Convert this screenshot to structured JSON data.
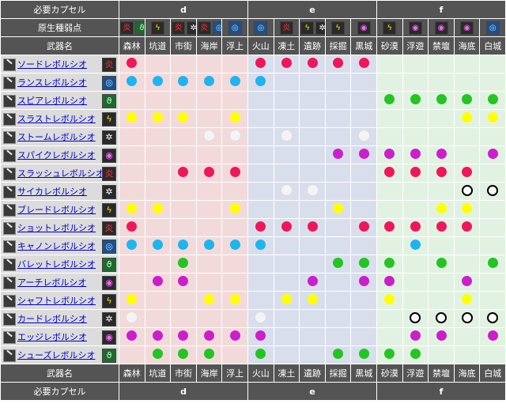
{
  "labels": {
    "capsule": "必要カプセル",
    "weakness": "原生種弱点",
    "weapon": "武器名"
  },
  "sections": [
    "d",
    "e",
    "f"
  ],
  "areas": [
    "森林",
    "坑道",
    "市街",
    "海岸",
    "浮上",
    "火山",
    "凍土",
    "遺跡",
    "採掘",
    "黒城",
    "砂漠",
    "浮遊",
    "禁壇",
    "海底",
    "白城"
  ],
  "area_sections": [
    "d",
    "d",
    "d",
    "d",
    "d",
    "e",
    "e",
    "e",
    "e",
    "e",
    "f",
    "f",
    "f",
    "f",
    "f"
  ],
  "area_weakness": [
    [
      "fire",
      "wind"
    ],
    [
      "thunder"
    ],
    [
      "fire",
      "ice"
    ],
    [
      "fire",
      "water"
    ],
    [
      "water"
    ],
    [
      "water"
    ],
    [
      "fire"
    ],
    [
      "thunder",
      "ice"
    ],
    [
      "thunder"
    ],
    [
      "dragon"
    ],
    [
      "thunder"
    ],
    [
      "dragon"
    ],
    [
      "dragon"
    ],
    [
      "dragon"
    ],
    [
      "water"
    ]
  ],
  "colors": {
    "red": "#f0165a",
    "cyan": "#1eb4f0",
    "green": "#22c522",
    "yellow": "#ffff00",
    "white": "#f4f4f4",
    "magenta": "#cc1ecc"
  },
  "weapons": [
    {
      "name": "ソードレボルシオ",
      "element": "fire",
      "color": "red",
      "cells": [
        1,
        0,
        0,
        0,
        0,
        1,
        1,
        1,
        1,
        1,
        0,
        0,
        0,
        0,
        0
      ]
    },
    {
      "name": "ランスレボルシオ",
      "element": "water",
      "color": "cyan",
      "cells": [
        1,
        1,
        1,
        1,
        1,
        1,
        0,
        0,
        0,
        0,
        0,
        0,
        0,
        0,
        0
      ]
    },
    {
      "name": "スピアレボルシオ",
      "element": "wind",
      "color": "green",
      "cells": [
        0,
        0,
        0,
        0,
        0,
        0,
        0,
        0,
        0,
        0,
        1,
        1,
        1,
        1,
        1
      ]
    },
    {
      "name": "スラストレボルシオ",
      "element": "thunder",
      "color": "yellow",
      "cells": [
        1,
        1,
        1,
        0,
        1,
        0,
        0,
        0,
        0,
        0,
        0,
        0,
        0,
        1,
        1
      ]
    },
    {
      "name": "ストームレボルシオ",
      "element": "ice",
      "color": "white",
      "cells": [
        0,
        0,
        0,
        1,
        1,
        0,
        1,
        0,
        0,
        1,
        0,
        0,
        0,
        0,
        0
      ]
    },
    {
      "name": "スパイクレボルシオ",
      "element": "dragon",
      "color": "magenta",
      "cells": [
        0,
        0,
        0,
        0,
        0,
        0,
        0,
        0,
        1,
        1,
        1,
        1,
        1,
        0,
        1
      ]
    },
    {
      "name": "スラッシュレボルシオ",
      "element": "fire",
      "color": "red",
      "cells": [
        0,
        0,
        1,
        1,
        1,
        0,
        0,
        0,
        0,
        0,
        1,
        1,
        1,
        1,
        0
      ]
    },
    {
      "name": "サイカレボルシオ",
      "element": "ice",
      "color": "white",
      "cells": [
        0,
        0,
        0,
        0,
        0,
        0,
        1,
        1,
        0,
        0,
        0,
        0,
        0,
        2,
        2
      ]
    },
    {
      "name": "ブレードレボルシオ",
      "element": "thunder",
      "color": "yellow",
      "cells": [
        1,
        1,
        0,
        0,
        1,
        0,
        0,
        0,
        1,
        0,
        0,
        0,
        1,
        1,
        0
      ]
    },
    {
      "name": "ショットレボルシオ",
      "element": "fire",
      "color": "red",
      "cells": [
        1,
        0,
        0,
        0,
        0,
        1,
        1,
        1,
        0,
        1,
        1,
        1,
        1,
        1,
        0
      ]
    },
    {
      "name": "キャノンレボルシオ",
      "element": "water",
      "color": "cyan",
      "cells": [
        1,
        1,
        1,
        1,
        1,
        1,
        0,
        0,
        0,
        0,
        0,
        1,
        0,
        0,
        0
      ]
    },
    {
      "name": "バレットレボルシオ",
      "element": "wind",
      "color": "green",
      "cells": [
        0,
        0,
        1,
        0,
        0,
        0,
        0,
        0,
        1,
        1,
        1,
        0,
        1,
        0,
        1
      ]
    },
    {
      "name": "アーチレボルシオ",
      "element": "dragon",
      "color": "magenta",
      "cells": [
        0,
        1,
        1,
        0,
        0,
        0,
        0,
        1,
        0,
        1,
        1,
        0,
        0,
        1,
        0
      ]
    },
    {
      "name": "シャフトレボルシオ",
      "element": "thunder",
      "color": "yellow",
      "cells": [
        1,
        0,
        0,
        1,
        1,
        0,
        1,
        1,
        0,
        0,
        1,
        0,
        0,
        1,
        0
      ]
    },
    {
      "name": "カードレボルシオ",
      "element": "ice",
      "color": "white",
      "cells": [
        1,
        0,
        0,
        0,
        0,
        1,
        0,
        0,
        0,
        0,
        0,
        2,
        2,
        2,
        2
      ]
    },
    {
      "name": "エッジレボルシオ",
      "element": "dragon",
      "color": "magenta",
      "cells": [
        1,
        1,
        1,
        1,
        1,
        1,
        0,
        0,
        0,
        0,
        0,
        1,
        1,
        0,
        1
      ]
    },
    {
      "name": "シューズレボルシオ",
      "element": "wind",
      "color": "green",
      "cells": [
        0,
        1,
        1,
        1,
        0,
        1,
        0,
        0,
        1,
        1,
        1,
        1,
        0,
        0,
        0
      ]
    }
  ],
  "element_glyphs": {
    "fire": "炎",
    "water": "◎",
    "thunder": "ϟ",
    "dragon": "◉",
    "wind": "ϑ",
    "ice": "✲"
  }
}
